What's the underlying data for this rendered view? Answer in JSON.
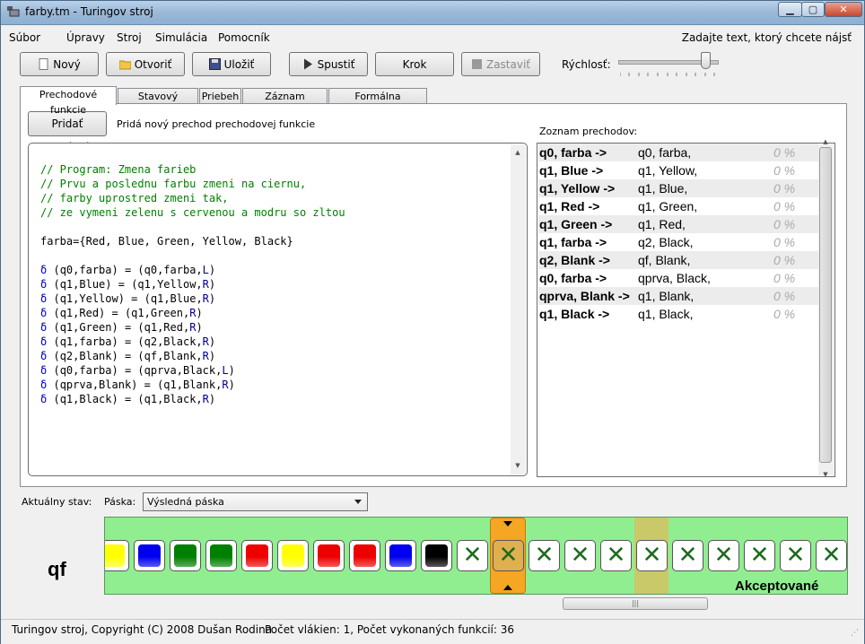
{
  "window": {
    "title": "farby.tm - Turingov stroj",
    "controls": [
      "minimize-icon",
      "maximize-icon",
      "close-icon"
    ]
  },
  "menu": {
    "items": [
      "Súbor",
      "Úpravy",
      "Stroj",
      "Simulácia",
      "Pomocník"
    ],
    "find_hint": "Zadajte text, ktorý chcete nájsť"
  },
  "toolbar": {
    "new": "Nový",
    "open": "Otvoriť",
    "save": "Uložiť",
    "run": "Spustiť",
    "step": "Krok",
    "stop": "Zastaviť",
    "speed_label": "Rýchlosť:",
    "speed_value_fraction": 0.88
  },
  "tabs": [
    "Prechodové funkcie",
    "Stavový diagram",
    "Priebeh",
    "Záznam priebehu",
    "Formálna špecifikácia"
  ],
  "active_tab": 0,
  "add_transition": {
    "label": "Pridať prechod",
    "description": "Pridá nový prechod prechodovej funkcie"
  },
  "code": {
    "comments": [
      "// Program: Zmena farieb",
      "// Prvu a poslednu farbu zmeni na ciernu,",
      "// farby uprostred zmeni tak,",
      "// ze vymeni zelenu s cervenou a modru so zltou"
    ],
    "alphabet": "farba={Red, Blue, Green, Yellow, Black}",
    "rules": [
      {
        "delta": "δ",
        "lhs": "(q0,farba)",
        "eq": " = ",
        "rhs_pre": "(q0,farba,",
        "dir": "L",
        "rhs_post": ")"
      },
      {
        "delta": "δ",
        "lhs": "(q1,Blue)",
        "eq": " = ",
        "rhs_pre": "(q1,Yellow,",
        "dir": "R",
        "rhs_post": ")"
      },
      {
        "delta": "δ",
        "lhs": "(q1,Yellow)",
        "eq": " = ",
        "rhs_pre": "(q1,Blue,",
        "dir": "R",
        "rhs_post": ")"
      },
      {
        "delta": "δ",
        "lhs": "(q1,Red)",
        "eq": " = ",
        "rhs_pre": "(q1,Green,",
        "dir": "R",
        "rhs_post": ")"
      },
      {
        "delta": "δ",
        "lhs": "(q1,Green)",
        "eq": " = ",
        "rhs_pre": "(q1,Red,",
        "dir": "R",
        "rhs_post": ")"
      },
      {
        "delta": "δ",
        "lhs": "(q1,farba)",
        "eq": " = ",
        "rhs_pre": "(q2,Black,",
        "dir": "R",
        "rhs_post": ")"
      },
      {
        "delta": "δ",
        "lhs": "(q2,Blank)",
        "eq": " = ",
        "rhs_pre": "(qf,Blank,",
        "dir": "R",
        "rhs_post": ")"
      },
      {
        "delta": "δ",
        "lhs": "(q0,farba)",
        "eq": " = ",
        "rhs_pre": "(qprva,Black,",
        "dir": "L",
        "rhs_post": ")"
      },
      {
        "delta": "δ",
        "lhs": "(qprva,Blank)",
        "eq": " = ",
        "rhs_pre": "(q1,Blank,",
        "dir": "R",
        "rhs_post": ")"
      },
      {
        "delta": "δ",
        "lhs": "(q1,Black)",
        "eq": " = ",
        "rhs_pre": "(q1,Black,",
        "dir": "R",
        "rhs_post": ")"
      }
    ]
  },
  "transitions_label": "Zoznam prechodov:",
  "transitions": [
    {
      "from": "q0, farba ->",
      "to": "q0, farba,",
      "pct": "0 %"
    },
    {
      "from": "q1, Blue ->",
      "to": "q1, Yellow,",
      "pct": "0 %"
    },
    {
      "from": "q1, Yellow ->",
      "to": "q1, Blue,",
      "pct": "0 %"
    },
    {
      "from": "q1, Red ->",
      "to": "q1, Green,",
      "pct": "0 %"
    },
    {
      "from": "q1, Green ->",
      "to": "q1, Red,",
      "pct": "0 %"
    },
    {
      "from": "q1, farba ->",
      "to": "q2, Black,",
      "pct": "0 %"
    },
    {
      "from": "q2, Blank ->",
      "to": "qf, Blank,",
      "pct": "0 %"
    },
    {
      "from": "q0, farba ->",
      "to": "qprva, Black,",
      "pct": "0 %"
    },
    {
      "from": "qprva, Blank ->",
      "to": "q1, Blank,",
      "pct": "0 %"
    },
    {
      "from": "q1, Black ->",
      "to": "q1, Black,",
      "pct": "0 %"
    }
  ],
  "state": {
    "label": "Aktuálny stav:",
    "current": "qf"
  },
  "tape": {
    "label": "Páska:",
    "selected": "Výsledná páska",
    "accepted_label": "Akceptované",
    "cells": [
      "Yellow",
      "Blue",
      "Green",
      "Green",
      "Red",
      "Yellow",
      "Red",
      "Red",
      "Blue",
      "Black",
      "Blank",
      "Blank",
      "Blank",
      "Blank",
      "Blank",
      "Blank",
      "Blank",
      "Blank",
      "Blank",
      "Blank",
      "Blank"
    ],
    "head_index": 11,
    "highlight_index": 15,
    "colors": {
      "Yellow": "#ffff00",
      "Blue": "#0000ee",
      "Green": "#008000",
      "Red": "#ee0000",
      "Black": "#000000",
      "background": "#90ee90",
      "head": "#f5a623"
    }
  },
  "status": {
    "copyright": "Turingov stroj, Copyright (C) 2008 Dušan Rodina",
    "info": "Počet vlákien: 1, Počet vykonaných funkcií: 36"
  }
}
